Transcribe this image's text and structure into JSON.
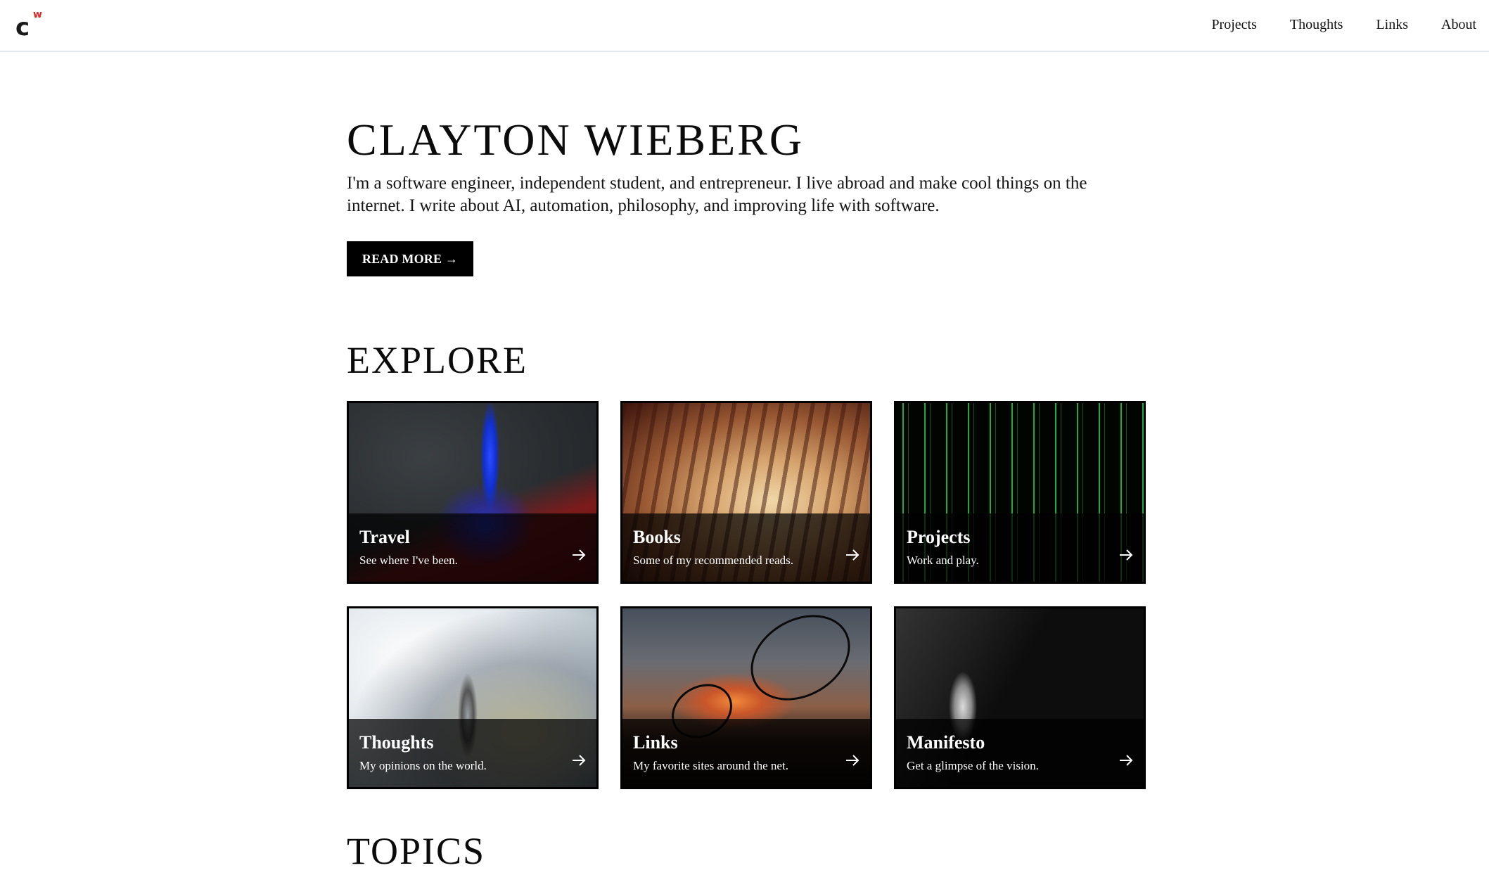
{
  "header": {
    "logo": {
      "main": "c",
      "superscript": "w",
      "accent_color": "#e02424"
    },
    "nav": [
      {
        "label": "Projects"
      },
      {
        "label": "Thoughts"
      },
      {
        "label": "Links"
      },
      {
        "label": "About"
      }
    ]
  },
  "hero": {
    "title": "CLAYTON WIEBERG",
    "description": "I'm a software engineer, independent student, and entrepreneur. I live abroad and make cool things on the internet. I write about AI, automation, philosophy, and improving life with software.",
    "button_label": "READ MORE →"
  },
  "explore": {
    "title": "EXPLORE",
    "cards": [
      {
        "title": "Travel",
        "subtitle": "See where I've been.",
        "image": "tokyo-tower-night",
        "arrow_icon": "arrow-right-icon"
      },
      {
        "title": "Books",
        "subtitle": "Some of my recommended reads.",
        "image": "stacked-books",
        "arrow_icon": "arrow-right-icon"
      },
      {
        "title": "Projects",
        "subtitle": "Work and play.",
        "image": "green-code-rain",
        "arrow_icon": "arrow-right-icon"
      },
      {
        "title": "Thoughts",
        "subtitle": "My opinions on the world.",
        "image": "astronaut-in-nebula",
        "arrow_icon": "arrow-right-icon"
      },
      {
        "title": "Links",
        "subtitle": "My favorite sites around the net.",
        "image": "radio-dishes-sunset",
        "arrow_icon": "arrow-right-icon"
      },
      {
        "title": "Manifesto",
        "subtitle": "Get a glimpse of the vision.",
        "image": "thinker-statue",
        "arrow_icon": "arrow-right-icon"
      }
    ]
  },
  "topics": {
    "title": "TOPICS"
  }
}
